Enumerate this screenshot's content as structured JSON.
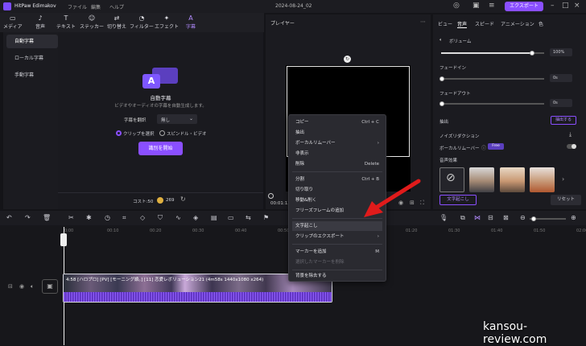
{
  "app": {
    "name": "HitPaw Edimakov",
    "date_title": "2024-08-24_02",
    "export_label": "エクスポート"
  },
  "menubar": [
    "ファイル",
    "編集",
    "ヘルプ"
  ],
  "media_tools": [
    {
      "label": "メディア",
      "icon": "folder-icon"
    },
    {
      "label": "音声",
      "icon": "music-icon"
    },
    {
      "label": "テキスト",
      "icon": "text-icon"
    },
    {
      "label": "ステッカー",
      "icon": "sticker-icon"
    },
    {
      "label": "切り替え",
      "icon": "transition-icon"
    },
    {
      "label": "フィルター",
      "icon": "filter-icon"
    },
    {
      "label": "エフェクト",
      "icon": "effect-icon"
    },
    {
      "label": "字幕",
      "icon": "subtitle-icon"
    }
  ],
  "sidebar": {
    "items": [
      "自動字幕",
      "ローカル字幕",
      "手動字幕"
    ]
  },
  "subtitle_panel": {
    "title": "自動字幕",
    "desc": "ビデオやオーディオの字幕を自動生成します。",
    "lang_label": "字幕を翻訳",
    "lang_value": "無し",
    "radio1": "クリップを選択",
    "radio2": "スピンドル・ビデオ",
    "start_button": "識別を開始",
    "cost_label": "コスト:50",
    "coins": "269"
  },
  "player": {
    "title": "プレイヤー",
    "time": "00:01:13"
  },
  "props": {
    "tabs": [
      "ビュー",
      "音声",
      "スピード",
      "アニメーション",
      "色"
    ],
    "volume_label": "ボリューム",
    "volume_value": "100%",
    "volume_level": 0.88,
    "fadein_label": "フェードイン",
    "fadein_value": "0s",
    "fadeout_label": "フェードアウト",
    "fadeout_value": "0s",
    "extract_label": "抽出",
    "extract_button": "抽出する",
    "noise_label": "ノイズリダクション",
    "vocal_label": "ボーカルリムーバー",
    "free_badge": "Free",
    "voice_effects_label": "音声効果",
    "text_button": "文字起こし",
    "reset_button": "リセット"
  },
  "context_menu": [
    {
      "label": "コピー",
      "shortcut": "Ctrl + C"
    },
    {
      "label": "抽出",
      "shortcut": ""
    },
    {
      "label": "ボーカルリムーバー",
      "shortcut": "›"
    },
    {
      "label": "非表示",
      "shortcut": ""
    },
    {
      "label": "削除",
      "shortcut": "Delete"
    },
    {
      "label": "分割",
      "shortcut": "Ctrl + B"
    },
    {
      "label": "切り取り",
      "shortcut": ""
    },
    {
      "label": "移動&削く",
      "shortcut": ""
    },
    {
      "label": "フリーズフレームの追加",
      "shortcut": ""
    },
    {
      "label": "文字起こし",
      "shortcut": ""
    },
    {
      "label": "クリップのエクスポート",
      "shortcut": "›"
    },
    {
      "label": "マーカーを追加",
      "shortcut": "M"
    },
    {
      "label": "選択したマーカーを削除",
      "shortcut": ""
    },
    {
      "label": "背景を除去する",
      "shortcut": ""
    }
  ],
  "timeline": {
    "ruler": [
      "0:00",
      "00:10",
      "00:20",
      "00:30",
      "00:40",
      "00:50",
      "01:00",
      "01:10",
      "01:20",
      "01:30",
      "01:40",
      "01:50",
      "02:00"
    ],
    "clip_label": "4:58 [ハロプロ] [PV] [モーニング娘。] [11] 恋愛レボリューション21 (4m58s 1440x1080 x264)"
  },
  "watermark": "kansou-review.com",
  "colors": {
    "accent": "#8a4fff",
    "arrow": "#e01b1b"
  }
}
